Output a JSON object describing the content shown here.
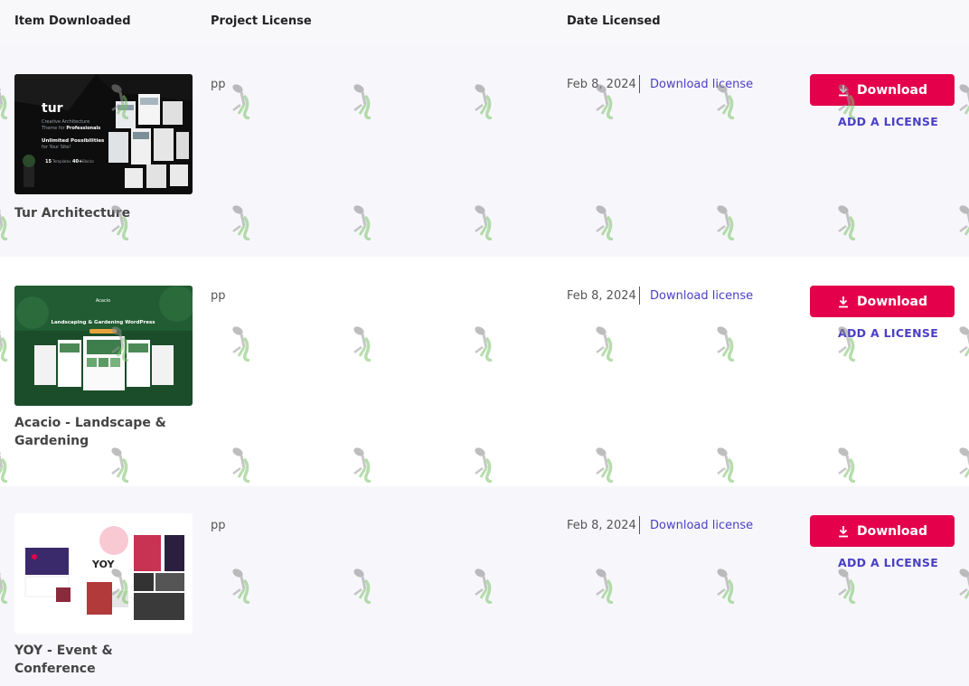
{
  "header": {
    "item_downloaded": "Item Downloaded",
    "project_license": "Project License",
    "date_licensed": "Date Licensed"
  },
  "rows": [
    {
      "title": "Tur Architecture",
      "license": "pp",
      "date": "Feb 8, 2024",
      "download_license": "Download license",
      "download_button": "Download",
      "add_license": "ADD A LICENSE",
      "thumb": {
        "logo": "tur",
        "tagline1": "Creative Architecture",
        "tagline2": "Theme for",
        "tagline2b": "Professionals",
        "headline1": "Unlimited Possibilities",
        "headline2": "for Your Site!",
        "stat1": "15",
        "stat1_label": "Templates",
        "stat2": "40+",
        "stat2_label": "Blocks"
      }
    },
    {
      "title": "Acacio - Landscape & Gardening",
      "license": "pp",
      "date": "Feb 8, 2024",
      "download_license": "Download license",
      "download_button": "Download",
      "add_license": "ADD A LICENSE",
      "thumb": {
        "logo": "Acacio",
        "headline": "Landscaping & Gardening WordPress"
      }
    },
    {
      "title": "YOY - Event & Conference",
      "license": "pp",
      "date": "Feb 8, 2024",
      "download_license": "Download license",
      "download_button": "Download",
      "add_license": "ADD A LICENSE",
      "thumb": {
        "logo": "YOY"
      }
    }
  ],
  "colors": {
    "primary_button": "#e4004b",
    "link": "#4a3fc5",
    "text_dark": "#222222"
  },
  "icons": {
    "download": "download-icon",
    "watermark": "watermark-icon"
  }
}
